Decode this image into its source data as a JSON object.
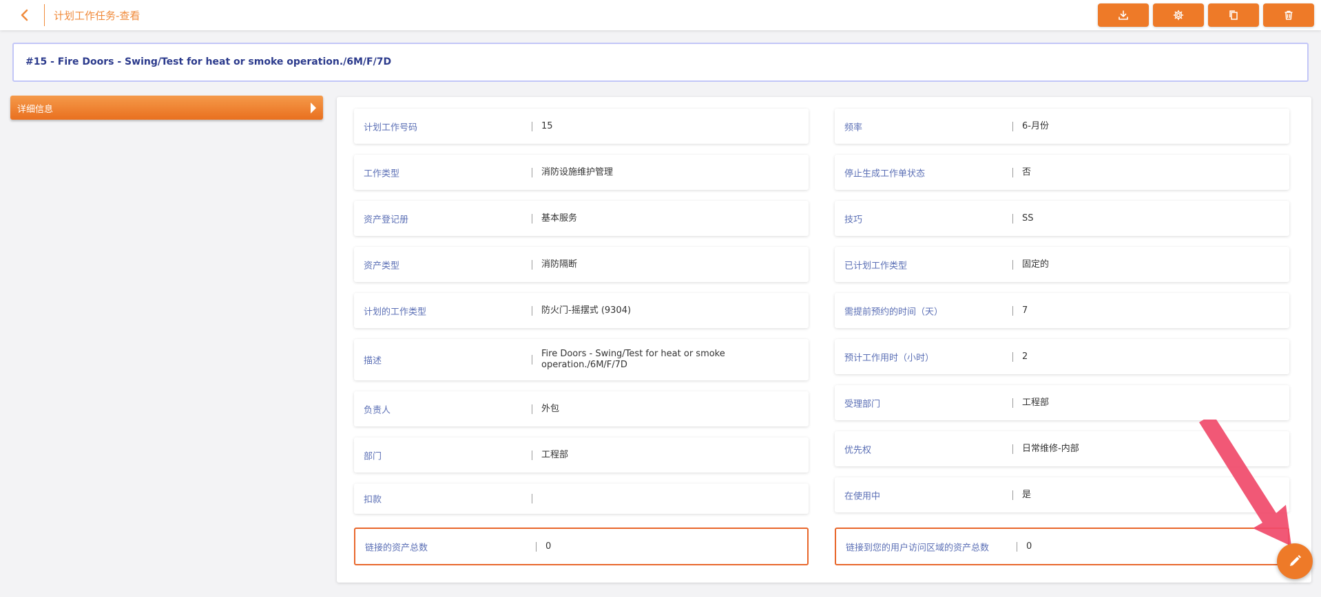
{
  "header": {
    "title": "计划工作任务-查看",
    "buttons": [
      {
        "icon": "download-icon"
      },
      {
        "icon": "gear-icon"
      },
      {
        "icon": "copy-icon"
      },
      {
        "icon": "trash-icon"
      }
    ]
  },
  "record": {
    "title": "#15 - Fire Doors - Swing/Test for heat or smoke operation./6M/F/7D"
  },
  "sidebar": {
    "tab_label": "详细信息"
  },
  "left_fields": [
    {
      "label": "计划工作号码",
      "value": "15"
    },
    {
      "label": "工作类型",
      "value": "消防设施维护管理"
    },
    {
      "label": "资产登记册",
      "value": "基本服务"
    },
    {
      "label": "资产类型",
      "value": "消防隔断"
    },
    {
      "label": "计划的工作类型",
      "value": "防火门-摇摆式 (9304)"
    },
    {
      "label": "描述",
      "value": "Fire Doors - Swing/Test for heat or smoke operation./6M/F/7D"
    },
    {
      "label": "负责人",
      "value": "外包"
    },
    {
      "label": "部门",
      "value": "工程部"
    },
    {
      "label": "扣款",
      "value": ""
    },
    {
      "label": "链接的资产总数",
      "value": "0"
    }
  ],
  "right_fields": [
    {
      "label": "频率",
      "value": "6-月份"
    },
    {
      "label": "停止生成工作单状态",
      "value": "否"
    },
    {
      "label": "技巧",
      "value": "SS"
    },
    {
      "label": "已计划工作类型",
      "value": "固定的"
    },
    {
      "label": "需提前预约的时间（天）",
      "value": "7"
    },
    {
      "label": "预计工作用时（小时）",
      "value": "2"
    },
    {
      "label": "受理部门",
      "value": "工程部"
    },
    {
      "label": "优先权",
      "value": "日常维修-内部"
    },
    {
      "label": "在使用中",
      "value": "是"
    },
    {
      "label": "链接到您的用户访问区域的资产总数",
      "value": "0"
    }
  ],
  "colors": {
    "accent": "#ee7a28",
    "label": "#5b6fb5",
    "title": "#2b3a8c",
    "highlight_border": "#e8662a",
    "annotation_arrow": "#f04a6a"
  },
  "fab": {
    "icon": "pencil-icon"
  }
}
